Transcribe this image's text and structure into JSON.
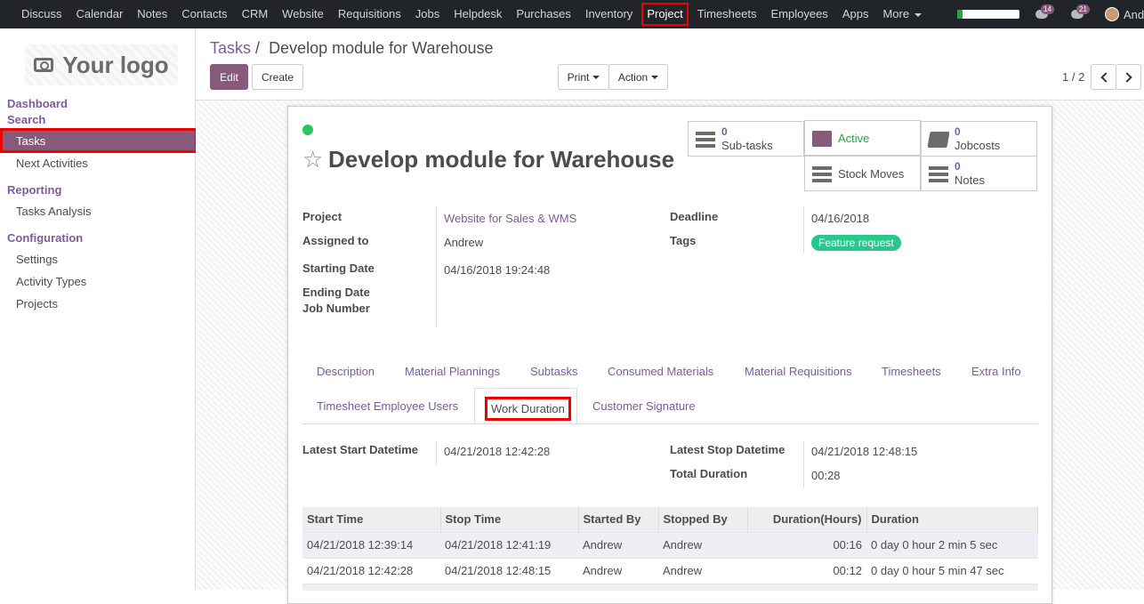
{
  "topnav": {
    "menu": [
      "Discuss",
      "Calendar",
      "Notes",
      "Contacts",
      "CRM",
      "Website",
      "Requisitions",
      "Jobs",
      "Helpdesk",
      "Purchases",
      "Inventory",
      "Project",
      "Timesheets",
      "Employees",
      "Apps",
      "More"
    ],
    "active": "Project",
    "progress_fraction": 0.08,
    "activity_count": "14",
    "message_count": "21",
    "user": "Andrew"
  },
  "sidebar": {
    "logo_text": "Your logo",
    "dashboard": "Dashboard",
    "search": "Search",
    "tasks": "Tasks",
    "next_activities": "Next Activities",
    "reporting": "Reporting",
    "tasks_analysis": "Tasks Analysis",
    "configuration": "Configuration",
    "settings": "Settings",
    "activity_types": "Activity Types",
    "projects": "Projects"
  },
  "control": {
    "breadcrumb_parent": "Tasks",
    "breadcrumb_sep": "/",
    "breadcrumb_current": "Develop module for Warehouse",
    "edit": "Edit",
    "create": "Create",
    "print": "Print",
    "action": "Action",
    "pager": "1 / 2"
  },
  "record": {
    "title": "Develop module for Warehouse",
    "smart_buttons": {
      "subtasks_count": "0",
      "subtasks_label": "Sub-tasks",
      "active_label": "Active",
      "jobcosts_count": "0",
      "jobcosts_label": "Jobcosts",
      "stock_moves_label": "Stock Moves",
      "notes_count": "0",
      "notes_label": "Notes"
    },
    "fields": {
      "project_label": "Project",
      "project_value": "Website for Sales & WMS",
      "assigned_label": "Assigned to",
      "assigned_value": "Andrew",
      "start_label": "Starting Date",
      "start_value": "04/16/2018 19:24:48",
      "end_label": "Ending Date",
      "job_label": "Job Number",
      "deadline_label": "Deadline",
      "deadline_value": "04/16/2018",
      "tags_label": "Tags",
      "tag_value": "Feature request"
    },
    "tabs_row1": [
      "Description",
      "Material Plannings",
      "Subtasks",
      "Consumed Materials",
      "Material Requisitions",
      "Timesheets",
      "Extra Info"
    ],
    "tabs_row2": [
      "Timesheet Employee Users",
      "Work Duration",
      "Customer Signature"
    ],
    "work": {
      "latest_start_label": "Latest Start Datetime",
      "latest_start_value": "04/21/2018 12:42:28",
      "latest_stop_label": "Latest Stop Datetime",
      "latest_stop_value": "04/21/2018 12:48:15",
      "total_label": "Total Duration",
      "total_value": "00:28"
    },
    "table": {
      "headers": [
        "Start Time",
        "Stop Time",
        "Started By",
        "Stopped By",
        "Duration(Hours)",
        "Duration"
      ],
      "rows": [
        [
          "04/21/2018 12:39:14",
          "04/21/2018 12:41:19",
          "Andrew",
          "Andrew",
          "00:16",
          "0 day 0 hour 2 min 5 sec"
        ],
        [
          "04/21/2018 12:42:28",
          "04/21/2018 12:48:15",
          "Andrew",
          "Andrew",
          "00:12",
          "0 day 0 hour 5 min 47 sec"
        ]
      ]
    }
  }
}
